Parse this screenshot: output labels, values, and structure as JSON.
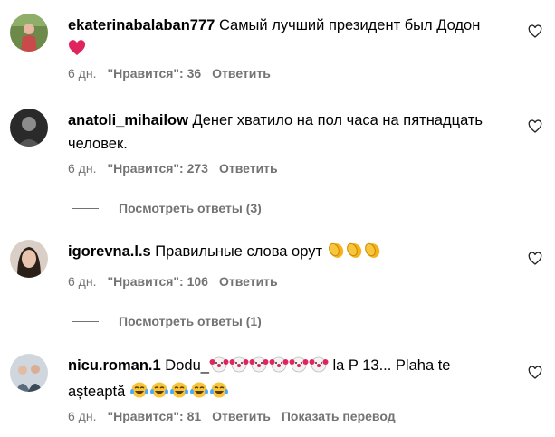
{
  "comments": [
    {
      "username": "ekaterinabalaban777",
      "text": "Самый лучший президент был Додон",
      "emoji": [
        "red-heart"
      ],
      "time": "6 дн.",
      "likes": "\"Нравится\": 36",
      "reply": "Ответить"
    },
    {
      "username": "anatoli_mihailow",
      "text": "Денег хватило на пол часа на пятнадцать человек.",
      "time": "6 дн.",
      "likes": "\"Нравится\": 273",
      "reply": "Ответить",
      "view_replies": "Посмотреть ответы (3)"
    },
    {
      "username": "igorevna.l.s",
      "text": "Правильные слова орут",
      "emoji": [
        "clapping-hands",
        "clapping-hands",
        "clapping-hands"
      ],
      "time": "6 дн.",
      "likes": "\"Нравится\": 106",
      "reply": "Ответить",
      "view_replies": "Посмотреть ответы (1)"
    },
    {
      "username": "nicu.roman.1",
      "text_a": "Dodu_",
      "text_b": " la P 13... Plaha te",
      "text_c": "așteaptă",
      "emoji_clowns": [
        "clown-face",
        "clown-face",
        "clown-face",
        "clown-face",
        "clown-face",
        "clown-face"
      ],
      "emoji_laugh": [
        "tears-of-joy",
        "tears-of-joy",
        "tears-of-joy",
        "tears-of-joy",
        "tears-of-joy"
      ],
      "time": "6 дн.",
      "likes": "\"Нравится\": 81",
      "reply": "Ответить",
      "translate": "Показать перевод"
    }
  ],
  "colors": {
    "secondary_text": "#737373",
    "heart_red": "#e0245e"
  }
}
